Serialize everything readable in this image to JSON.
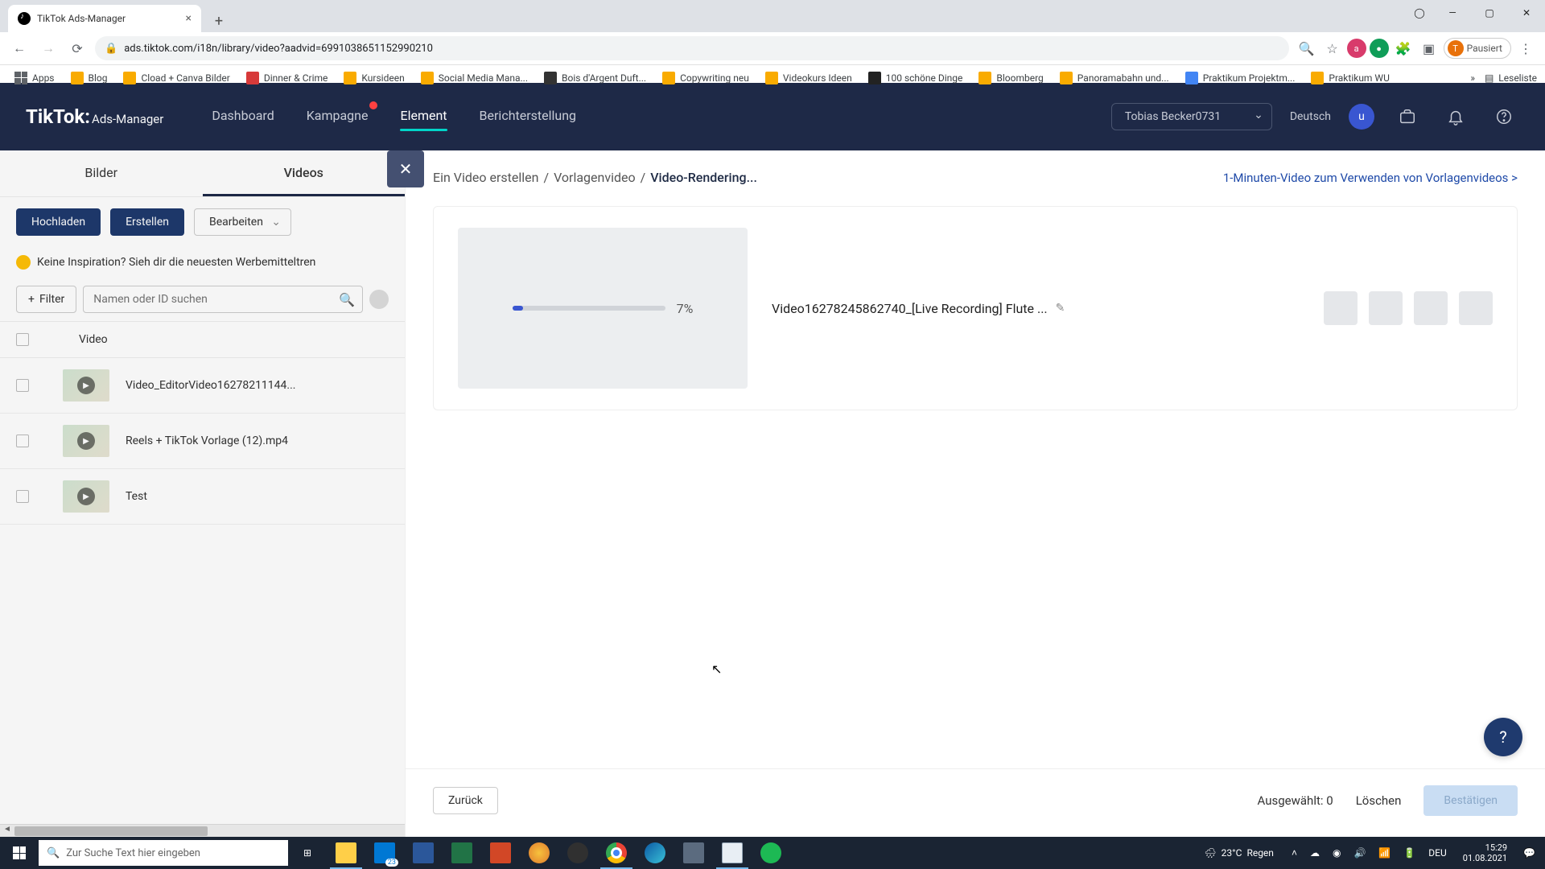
{
  "browser": {
    "tab_title": "TikTok Ads-Manager",
    "url": "ads.tiktok.com/i18n/library/video?aadvid=6991038651152990210",
    "pausiert": "Pausiert",
    "reading_list": "Leseliste",
    "apps_label": "Apps",
    "bookmarks": [
      "Blog",
      "Cload + Canva Bilder",
      "Dinner & Crime",
      "Kursideen",
      "Social Media Mana...",
      "Bois d'Argent Duft...",
      "Copywriting neu",
      "Videokurs Ideen",
      "100 schöne Dinge",
      "Bloomberg",
      "Panoramabahn und...",
      "Praktikum Projektm...",
      "Praktikum WU"
    ]
  },
  "header": {
    "logo_main": "TikTok:",
    "logo_sub": "Ads-Manager",
    "nav": {
      "dashboard": "Dashboard",
      "kampagne": "Kampagne",
      "element": "Element",
      "bericht": "Berichterstellung"
    },
    "account": "Tobias Becker0731",
    "language": "Deutsch",
    "avatar_letter": "u"
  },
  "sidebar": {
    "tabs": {
      "bilder": "Bilder",
      "videos": "Videos"
    },
    "buttons": {
      "hochladen": "Hochladen",
      "erstellen": "Erstellen",
      "bearbeiten": "Bearbeiten"
    },
    "inspiration": "Keine Inspiration? Sieh dir die neuesten Werbemitteltren",
    "filter_label": "Filter",
    "search_placeholder": "Namen oder ID suchen",
    "col_video": "Video",
    "rows": [
      {
        "name": "Video_EditorVideo16278211144..."
      },
      {
        "name": "Reels + TikTok Vorlage (12).mp4"
      },
      {
        "name": "Test"
      }
    ]
  },
  "panel": {
    "breadcrumb": {
      "a": "Ein Video erstellen",
      "b": "Vorlagenvideo",
      "c": "Video-Rendering..."
    },
    "tutorial": "1-Minuten-Video zum Verwenden von Vorlagenvideos >",
    "progress_pct": "7%",
    "render_name": "Video16278245862740_[Live Recording] Flute ...",
    "footer": {
      "back": "Zurück",
      "selected_label": "Ausgewählt:",
      "selected_count": "0",
      "delete": "Löschen",
      "confirm": "Bestätigen"
    }
  },
  "taskbar": {
    "search_placeholder": "Zur Suche Text hier eingeben",
    "weather_temp": "23°C",
    "weather_text": "Regen",
    "lang": "DEU",
    "time": "15:29",
    "date": "01.08.2021",
    "mail_badge": "23"
  }
}
